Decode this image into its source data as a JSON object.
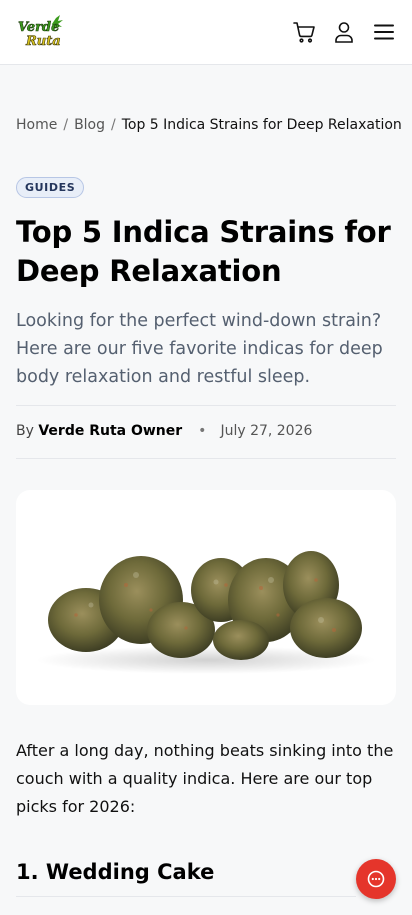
{
  "header": {
    "logo_text_line1": "Verde",
    "logo_text_line2": "Ruta",
    "icons": [
      "cart-icon",
      "account-icon",
      "menu-icon"
    ]
  },
  "breadcrumb": {
    "items": [
      "Home",
      "Blog"
    ],
    "separator": "/",
    "current": "Top 5 Indica Strains for Deep Relaxation"
  },
  "article": {
    "category": "GUIDES",
    "title": "Top 5 Indica Strains for Deep Relaxation",
    "excerpt": "Looking for the perfect wind-down strain? Here are our five favorite indicas for deep body relaxation and restful sleep.",
    "by_label": "By",
    "author": "Verde Ruta Owner",
    "meta_dot": "•",
    "date": "July 27, 2026",
    "intro": "After a long day, nothing beats sinking into the couch with a quality indica. Here are our top picks for 2026:",
    "first_heading": "1. Wedding Cake"
  },
  "colors": {
    "accent_badge_bg": "#e8eef8",
    "chat_button": "#e5352b",
    "logo_green": "#3a9a1c",
    "logo_yellow": "#d8c31e"
  }
}
